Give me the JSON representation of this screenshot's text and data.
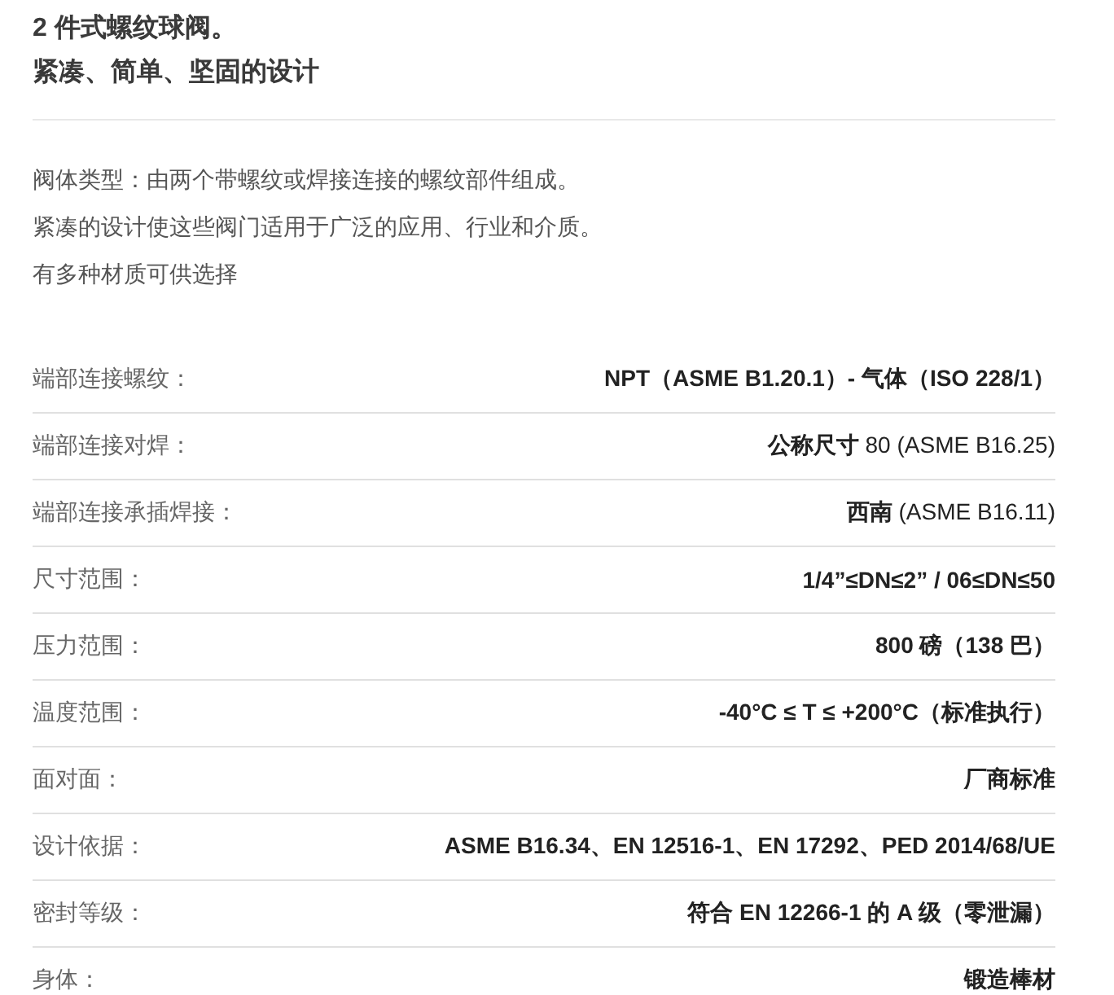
{
  "title_lines": [
    "2 件式螺纹球阀。",
    "紧凑、简单、坚固的设计"
  ],
  "paragraphs": [
    "阀体类型：由两个带螺纹或焊接连接的螺纹部件组成。",
    "紧凑的设计使这些阀门适用于广泛的应用、行业和介质。",
    "有多种材质可供选择"
  ],
  "specs": [
    {
      "label": "端部连接螺纹：",
      "value": "NPT（ASME B1.20.1）- 气体（ISO 228/1）",
      "emphasis": true
    },
    {
      "label": "端部连接对焊：",
      "value": "**公称尺寸** 80 (ASME B16.25)",
      "emphasis": false
    },
    {
      "label": "端部连接承插焊接：",
      "value": "**西南** (ASME B16.11)",
      "emphasis": false
    },
    {
      "label": "尺寸范围：",
      "value": "1/4”≤DN≤2” / 06≤DN≤50",
      "emphasis": true
    },
    {
      "label": "压力范围：",
      "value": "800 磅（138 巴）",
      "emphasis": true
    },
    {
      "label": "温度范围：",
      "value": "-40°C ≤ T ≤ +200°C（标准执行）",
      "emphasis": true
    },
    {
      "label": "面对面：",
      "value": "厂商标准",
      "emphasis": true
    },
    {
      "label": "设计依据：",
      "value": "ASME B16.34、EN 12516-1、EN 17292、PED 2014/68/UE",
      "emphasis": true
    },
    {
      "label": "密封等级：",
      "value": "符合 EN 12266-1 的 A 级（零泄漏）",
      "emphasis": true
    },
    {
      "label": "身体：",
      "value": "锻造棒材",
      "emphasis": true
    }
  ]
}
